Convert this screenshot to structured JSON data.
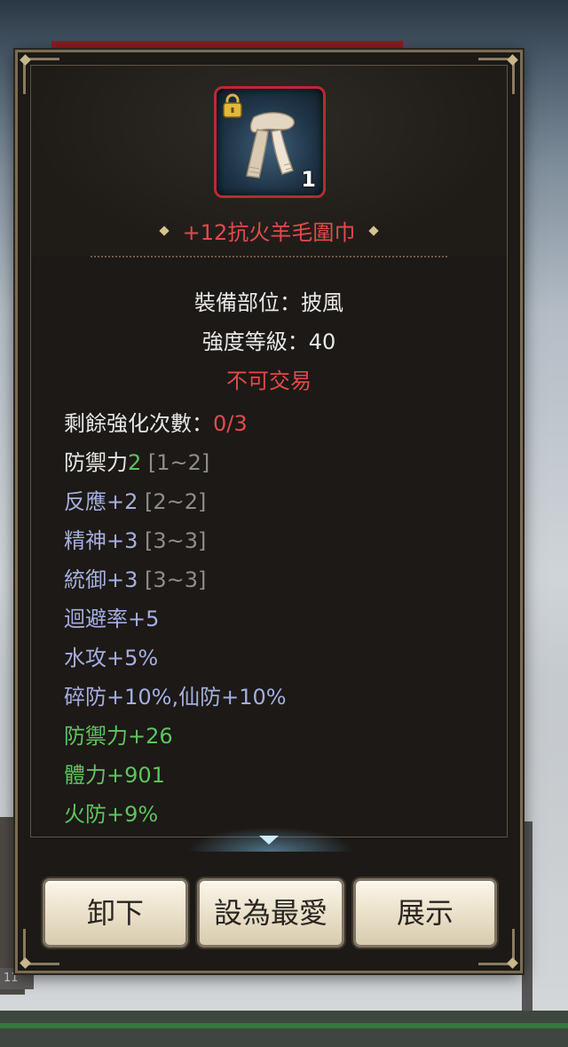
{
  "item": {
    "name": "+12抗火羊毛圍巾",
    "count": "1",
    "icon": "scarf-icon",
    "locked_icon": "lock-icon"
  },
  "info": {
    "slot": "裝備部位：披風",
    "level": "強度等級：40",
    "trade": "不可交易"
  },
  "enhance": {
    "label": "剩餘強化次數：",
    "value": "0/3"
  },
  "stats": [
    {
      "label": "防禦力",
      "value": "2",
      "range": "[1~2]"
    },
    {
      "label": "反應+2",
      "value": "",
      "range": "[2~2]"
    },
    {
      "label": "精神+3",
      "value": "",
      "range": "[3~3]"
    },
    {
      "label": "統御+3",
      "value": "",
      "range": "[3~3]"
    },
    {
      "label": "迴避率+5",
      "value": "",
      "range": ""
    },
    {
      "label": "水攻+5%",
      "value": "",
      "range": ""
    },
    {
      "label": "碎防+10%,仙防+10%",
      "value": "",
      "range": ""
    }
  ],
  "bonus_stats": [
    "防禦力+26",
    "體力+901",
    "火防+9%"
  ],
  "buttons": {
    "unequip": "卸下",
    "favorite": "設為最愛",
    "show": "展示"
  },
  "background": {
    "badge": "11"
  },
  "colors": {
    "name": "#e24a4d",
    "green": "#5fc35d",
    "blue": "#a5aee0",
    "gray": "#8d8d8d",
    "frame": "#b72b33"
  }
}
